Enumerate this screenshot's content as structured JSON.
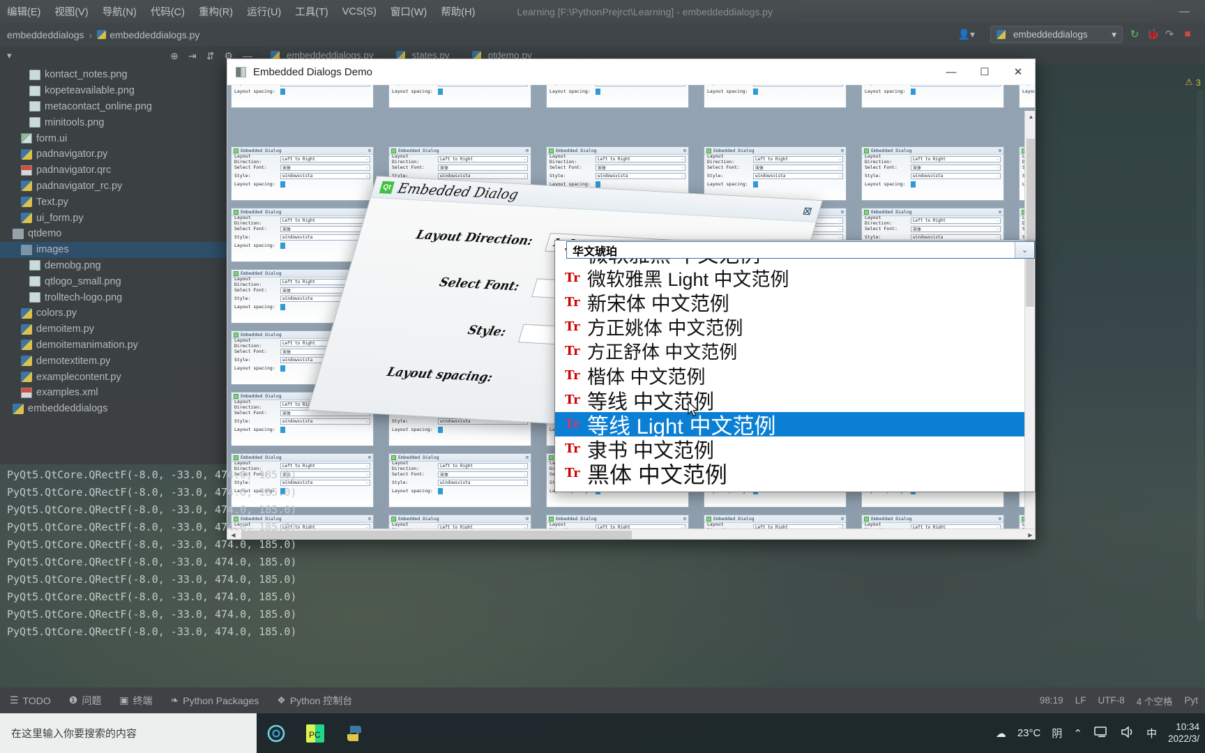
{
  "ide": {
    "menu": [
      "编辑(E)",
      "视图(V)",
      "导航(N)",
      "代码(C)",
      "重构(R)",
      "运行(U)",
      "工具(T)",
      "VCS(S)",
      "窗口(W)",
      "帮助(H)"
    ],
    "window_title": "Learning [F:\\PythonPrejrct\\Learning] - embeddeddialogs.py",
    "minimize_glyph": "—",
    "breadcrumb": {
      "project": "embeddeddialogs",
      "separator": "›",
      "file": "embeddeddialogs.py"
    },
    "run_config": {
      "label": "embeddeddialogs",
      "chevron": "▾"
    },
    "persona_glyph": "👤▾",
    "right_icons": [
      "↻",
      "🐞",
      "↷",
      "■"
    ],
    "tabs": [
      {
        "label": "embeddeddialogs.py",
        "active": true
      },
      {
        "label": "states.py",
        "active": false
      },
      {
        "label": "ptdemo.py",
        "active": false
      }
    ],
    "project_panel": {
      "collapse_glyph": "▾",
      "tool_icons": [
        "⊕",
        "⇥",
        "⇵",
        "⚙",
        "—"
      ],
      "items": [
        {
          "label": "kontact_notes.png",
          "icon": "png",
          "indent": 3,
          "selected": false
        },
        {
          "label": "kopeteavailable.png",
          "icon": "png",
          "indent": 3,
          "selected": false
        },
        {
          "label": "metacontact_online.png",
          "icon": "png",
          "indent": 3,
          "selected": false
        },
        {
          "label": "minitools.png",
          "icon": "png",
          "indent": 3,
          "selected": false
        },
        {
          "label": "form.ui",
          "icon": "ui",
          "indent": 2,
          "selected": false
        },
        {
          "label": "padnavigator.py",
          "icon": "py",
          "indent": 2,
          "selected": false
        },
        {
          "label": "padnavigator.qrc",
          "icon": "qrc",
          "indent": 2,
          "selected": false
        },
        {
          "label": "padnavigator_rc.py",
          "icon": "py",
          "indent": 2,
          "selected": false
        },
        {
          "label": "Text.py",
          "icon": "py",
          "indent": 2,
          "selected": false
        },
        {
          "label": "ui_form.py",
          "icon": "py",
          "indent": 2,
          "selected": false
        },
        {
          "label": "qtdemo",
          "icon": "mod",
          "indent": 1,
          "selected": false
        },
        {
          "label": "images",
          "icon": "folder",
          "indent": 2,
          "selected": true
        },
        {
          "label": "demobg.png",
          "icon": "png",
          "indent": 3,
          "selected": false
        },
        {
          "label": "qtlogo_small.png",
          "icon": "png",
          "indent": 3,
          "selected": false
        },
        {
          "label": "trolltech-logo.png",
          "icon": "png",
          "indent": 3,
          "selected": false
        },
        {
          "label": "colors.py",
          "icon": "py",
          "indent": 2,
          "selected": false
        },
        {
          "label": "demoitem.py",
          "icon": "py",
          "indent": 2,
          "selected": false
        },
        {
          "label": "demoitemanimation.py",
          "icon": "py",
          "indent": 2,
          "selected": false
        },
        {
          "label": "demotextitem.py",
          "icon": "py",
          "indent": 2,
          "selected": false
        },
        {
          "label": "examplecontent.py",
          "icon": "py",
          "indent": 2,
          "selected": false
        },
        {
          "label": "examples.xml",
          "icon": "xml",
          "indent": 2,
          "selected": false
        },
        {
          "label": "embeddeddialogs",
          "icon": "py",
          "indent": 1,
          "selected": false
        }
      ]
    },
    "console_lines": [
      "PyQt5.QtCore.QRectF(-8.0, -33.0, 474.0, 185.0)",
      "PyQt5.QtCore.QRectF(-8.0, -33.0, 474.0, 185.0)",
      "PyQt5.QtCore.QRectF(-8.0, -33.0, 474.0, 185.0)",
      "PyQt5.QtCore.QRectF(-8.0, -33.0, 474.0, 185.0)",
      "PyQt5.QtCore.QRectF(-8.0, -33.0, 474.0, 185.0)",
      "PyQt5.QtCore.QRectF(-8.0, -33.0, 474.0, 185.0)",
      "PyQt5.QtCore.QRectF(-8.0, -33.0, 474.0, 185.0)",
      "PyQt5.QtCore.QRectF(-8.0, -33.0, 474.0, 185.0)",
      "PyQt5.QtCore.QRectF(-8.0, -33.0, 474.0, 185.0)",
      "PyQt5.QtCore.QRectF(-8.0, -33.0, 474.0, 185.0)"
    ],
    "bottom_tools": [
      {
        "label": "TODO",
        "icon": "list-icon"
      },
      {
        "label": "问题",
        "icon": "warning-icon"
      },
      {
        "label": "终端",
        "icon": "terminal-icon"
      },
      {
        "label": "Python Packages",
        "icon": "packages-icon"
      },
      {
        "label": "Python 控制台",
        "icon": "python-console-icon"
      }
    ],
    "status_right": [
      "98:19",
      "LF",
      "UTF-8",
      "4 个空格",
      "Pyt"
    ],
    "inspection_badge": {
      "glyph": "⚠",
      "count": "3"
    }
  },
  "qt_app": {
    "title": "Embedded Dialogs Demo",
    "window_buttons": {
      "minimize": "—",
      "maximize": "☐",
      "close": "✕"
    },
    "card_template": {
      "title": "Embedded Dialog",
      "close_glyph": "⊠",
      "rows": [
        {
          "label": "Layout Direction:",
          "value": "Left to Right"
        },
        {
          "label": "Select Font:",
          "value": "宋体"
        },
        {
          "label": "Style:",
          "value": "windowsvista"
        },
        {
          "label": "Layout spacing:",
          "value": ""
        }
      ]
    },
    "scroll": {
      "up": "▲",
      "down": "▼",
      "left": "◀",
      "right": "▶"
    }
  },
  "big_dialog": {
    "title": "Embedded Dialog",
    "qt_badge": "Qt",
    "close_glyph": "⊠",
    "fields": [
      {
        "label": "Layout Direction:",
        "value": "Left to Right",
        "caret": "⌄"
      },
      {
        "label": "Select Font:",
        "value": "",
        "caret": "⌄"
      },
      {
        "label": "Style:",
        "value": "",
        "caret": "⌄"
      },
      {
        "label": "Layout spacing:",
        "value": "",
        "caret": ""
      }
    ]
  },
  "font_popup": {
    "current_value": "华文琥珀",
    "dropdown_glyph": "⌄",
    "tt_glyph": "Tr",
    "items": [
      {
        "name": "微软雅黑 中文范例",
        "selected": false
      },
      {
        "name": "微软雅黑 Light 中文范例",
        "selected": false
      },
      {
        "name": "新宋体 中文范例",
        "selected": false
      },
      {
        "name": "方正姚体 中文范例",
        "selected": false
      },
      {
        "name": "方正舒体 中文范例",
        "selected": false
      },
      {
        "name": "楷体 中文范例",
        "selected": false
      },
      {
        "name": "等线 中文范例",
        "selected": false
      },
      {
        "name": "等线 Light 中文范例",
        "selected": true
      },
      {
        "name": "隶书 中文范例",
        "selected": false
      },
      {
        "name": "黑体 中文范例",
        "selected": false
      }
    ]
  },
  "taskbar": {
    "search_placeholder": "在这里输入你要搜索的内容",
    "pinned": [
      {
        "name": "cortana-icon",
        "glyph": "◎"
      },
      {
        "name": "pycharm-icon",
        "glyph": "PC"
      },
      {
        "name": "python-app-icon",
        "glyph": "🐍"
      }
    ],
    "tray": {
      "weather_icon": "☁",
      "weather_temp": "23°C",
      "weather_desc": "阴",
      "chevron": "⌃",
      "network_icon": "🖥",
      "volume_icon": "🔊",
      "ime_label": "中",
      "time": "10:34",
      "date": "2022/3/"
    }
  },
  "colors": {
    "ide_bg": "#3c4043",
    "accent_selection": "#2f4f6b",
    "popup_selection": "#0a7fd4",
    "qt_green": "#3ec13e",
    "warning": "#d7b14b"
  }
}
